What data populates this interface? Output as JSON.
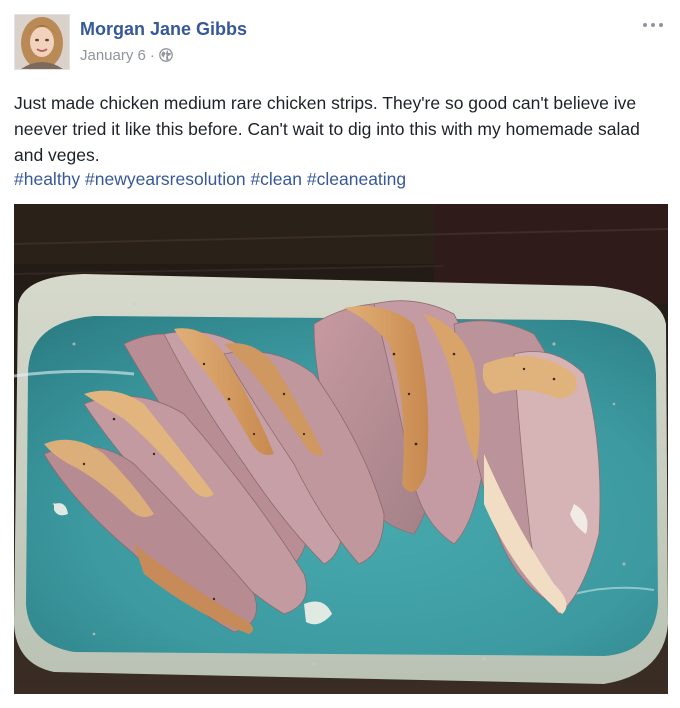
{
  "post": {
    "author": "Morgan Jane Gibbs",
    "date": "January 6",
    "separator": "·",
    "text": "Just made chicken medium rare chicken strips. They're so good can't believe ive neever tried it like this before. Can't wait to dig into this with my homemade salad and veges.",
    "hashtags": [
      "#healthy",
      "#newyearsresolution",
      "#clean",
      "#cleaneating"
    ],
    "privacy_icon": "globe-icon",
    "menu_icon": "more-options-icon"
  },
  "colors": {
    "author_link": "#365899",
    "meta_gray": "#90949c",
    "body_text": "#1d2129",
    "plate_teal": "#3fa0a6"
  }
}
